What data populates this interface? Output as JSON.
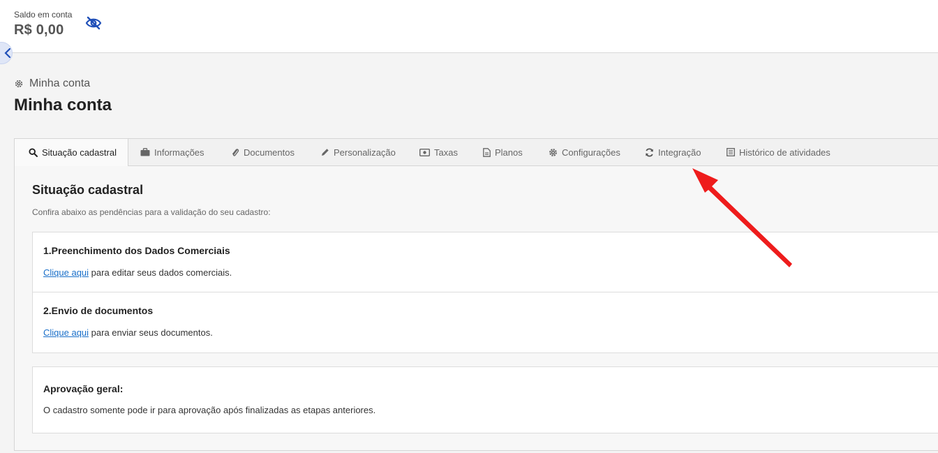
{
  "header": {
    "balance_label": "Saldo em conta",
    "balance_value": "R$ 0,00",
    "visibility_icon": "eye-off-icon"
  },
  "breadcrumb": {
    "icon": "gear-icon",
    "label": "Minha conta"
  },
  "page": {
    "title": "Minha conta"
  },
  "tabs": [
    {
      "label": "Situação cadastral",
      "icon": "search-icon",
      "active": true
    },
    {
      "label": "Informações",
      "icon": "briefcase-icon"
    },
    {
      "label": "Documentos",
      "icon": "paperclip-icon"
    },
    {
      "label": "Personalização",
      "icon": "pencil-icon"
    },
    {
      "label": "Taxas",
      "icon": "money-icon"
    },
    {
      "label": "Planos",
      "icon": "document-icon"
    },
    {
      "label": "Configurações",
      "icon": "cog-icon"
    },
    {
      "label": "Integração",
      "icon": "refresh-icon"
    },
    {
      "label": "Histórico de atividades",
      "icon": "list-icon"
    }
  ],
  "section": {
    "title": "Situação cadastral",
    "description": "Confira abaixo as pendências para a validação do seu cadastro:"
  },
  "steps": [
    {
      "title": "1.Preenchimento dos Dados Comerciais",
      "link": "Clique aqui",
      "text": " para editar seus dados comerciais."
    },
    {
      "title": "2.Envio de documentos",
      "link": "Clique aqui",
      "text": " para enviar seus documentos."
    }
  ],
  "approval": {
    "title": "Aprovação geral:",
    "text": "O cadastro somente pode ir para aprovação após finalizadas as etapas anteriores."
  },
  "colors": {
    "link": "#1a6fc9",
    "eye_icon": "#1f4fb8",
    "annotation_arrow": "#ee1c1c"
  }
}
